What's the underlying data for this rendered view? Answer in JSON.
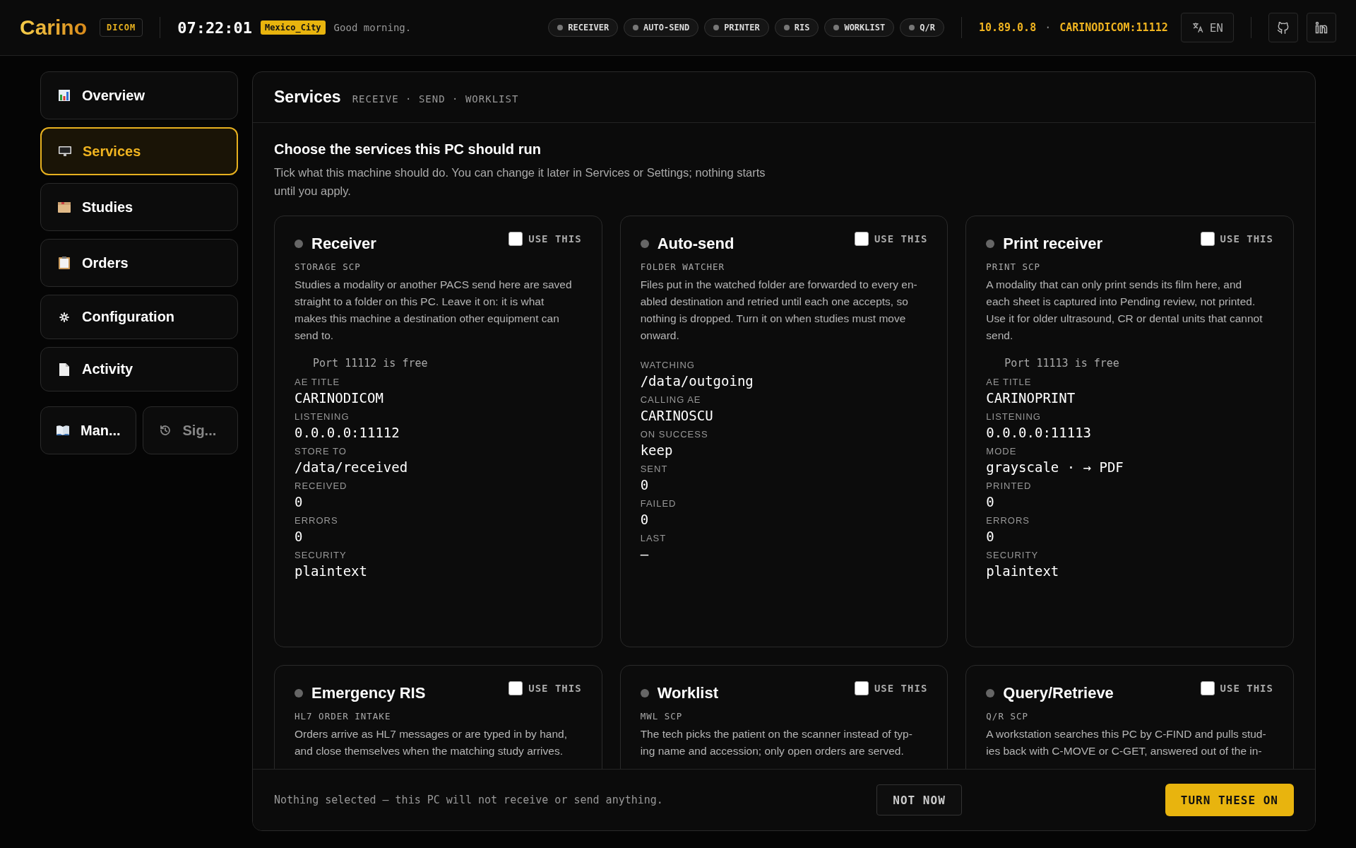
{
  "header": {
    "logo": "Carino",
    "product_badge": "DICOM",
    "clock": "07:22:01",
    "timezone": "Mexico_City",
    "greeting": "Good morning.",
    "status_pills": [
      {
        "label": "RECEIVER"
      },
      {
        "label": "AUTO-SEND"
      },
      {
        "label": "PRINTER"
      },
      {
        "label": "RIS"
      },
      {
        "label": "WORKLIST"
      },
      {
        "label": "Q/R"
      }
    ],
    "ip": "10.89.0.8",
    "separator": "·",
    "ae_port": "CARINODICOM:11112",
    "language": "EN"
  },
  "sidebar": {
    "items": [
      {
        "label": "Overview",
        "selected": false
      },
      {
        "label": "Services",
        "selected": true
      },
      {
        "label": "Studies",
        "selected": false
      },
      {
        "label": "Orders",
        "selected": false
      },
      {
        "label": "Configuration",
        "selected": false
      },
      {
        "label": "Activity",
        "selected": false
      }
    ],
    "small_items": [
      {
        "label": "Man...",
        "disabled": false
      },
      {
        "label": "Sig...",
        "disabled": true
      }
    ]
  },
  "panel": {
    "title": "Services",
    "subtitle": "RECEIVE · SEND · WORKLIST",
    "heading": "Choose the services this PC should run",
    "intro": "Tick what this machine should do. You can change it later in Services or Settings; nothing starts until you apply.",
    "cards": [
      {
        "title": "Receiver",
        "checkbox_label": "USE THIS",
        "checked": false,
        "subtitle": "STORAGE SCP",
        "description": [
          "Studies a modality or another PACS send here are saved",
          "straight to a folder on this PC. Leave it on: it is what",
          "makes this machine a destination other equipment can",
          "send to."
        ],
        "port_note": "Port 11112 is free",
        "fields": [
          {
            "label": "AE TITLE",
            "value": "CARINODICOM"
          },
          {
            "label": "LISTENING",
            "value": "0.0.0.0:11112"
          },
          {
            "label": "STORE TO",
            "value": "/data/received"
          },
          {
            "label": "RECEIVED",
            "value": "0"
          },
          {
            "label": "ERRORS",
            "value": "0"
          },
          {
            "label": "SECURITY",
            "value": "plaintext"
          }
        ]
      },
      {
        "title": "Auto-send",
        "checkbox_label": "USE THIS",
        "checked": false,
        "subtitle": "FOLDER WATCHER",
        "description": [
          "Files put in the watched folder are forwarded to every en-",
          "abled destination and retried until each one accepts, so",
          "nothing is dropped. Turn it on when studies must move",
          "onward."
        ],
        "fields": [
          {
            "label": "WATCHING",
            "value": "/data/outgoing"
          },
          {
            "label": "CALLING AE",
            "value": "CARINOSCU"
          },
          {
            "label": "ON SUCCESS",
            "value": "keep"
          },
          {
            "label": "SENT",
            "value": "0"
          },
          {
            "label": "FAILED",
            "value": "0"
          },
          {
            "label": "LAST",
            "value": "—"
          }
        ]
      },
      {
        "title": "Print receiver",
        "checkbox_label": "USE THIS",
        "checked": false,
        "subtitle": "PRINT SCP",
        "description": [
          "A modality that can only print sends its film here, and",
          "each sheet is captured into Pending review, not printed.",
          "Use it for older ultrasound, CR or dental units that cannot",
          "send."
        ],
        "port_note": "Port 11113 is free",
        "fields": [
          {
            "label": "AE TITLE",
            "value": "CARINOPRINT"
          },
          {
            "label": "LISTENING",
            "value": "0.0.0.0:11113"
          },
          {
            "label": "MODE",
            "value": "grayscale · → PDF"
          },
          {
            "label": "PRINTED",
            "value": "0"
          },
          {
            "label": "ERRORS",
            "value": "0"
          },
          {
            "label": "SECURITY",
            "value": "plaintext"
          }
        ]
      },
      {
        "title": "Emergency RIS",
        "checkbox_label": "USE THIS",
        "checked": false,
        "subtitle": "HL7 ORDER INTAKE",
        "description": [
          "Orders arrive as HL7 messages or are typed in by hand,",
          "and close themselves when the matching study arrives."
        ]
      },
      {
        "title": "Worklist",
        "checkbox_label": "USE THIS",
        "checked": false,
        "subtitle": "MWL SCP",
        "description": [
          "The tech picks the patient on the scanner instead of typ-",
          "ing name and accession; only open orders are served."
        ]
      },
      {
        "title": "Query/Retrieve",
        "checkbox_label": "USE THIS",
        "checked": false,
        "subtitle": "Q/R SCP",
        "description": [
          "A workstation searches this PC by C-FIND and pulls stud-",
          "ies back with C-MOVE or C-GET, answered out of the in-"
        ]
      }
    ],
    "footer_note": "Nothing selected — this PC will not receive or send anything.",
    "secondary_button": "NOT NOW",
    "primary_button": "TURN THESE ON"
  }
}
